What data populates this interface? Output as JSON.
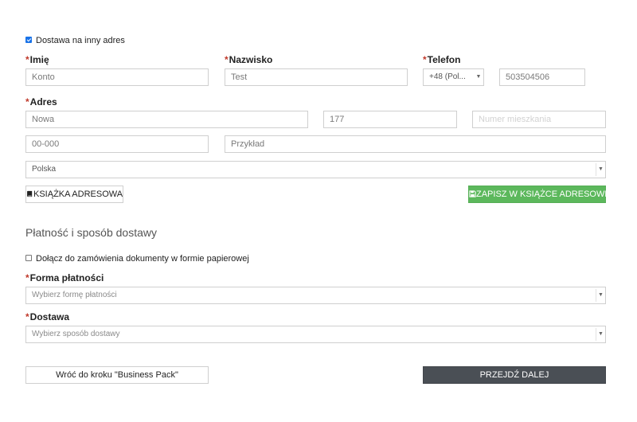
{
  "delivery_other_address": {
    "label": "Dostawa na inny adres",
    "checked": true
  },
  "fields": {
    "first_name": {
      "label": "Imię",
      "value": "Konto"
    },
    "last_name": {
      "label": "Nazwisko",
      "value": "Test"
    },
    "phone": {
      "label": "Telefon",
      "prefix": "+48 (Pol...",
      "value": "503504506"
    },
    "address": {
      "label": "Adres",
      "street": "Nowa",
      "building": "177",
      "apartment_placeholder": "Numer mieszkania",
      "postal_code": "00-000",
      "city": "Przykład",
      "country": "Polska"
    }
  },
  "buttons": {
    "address_book": "KSIĄŻKA ADRESOWA",
    "save_address_book": "ZAPISZ W KSIĄŻCE ADRESOWEJ",
    "back": "Wróć do kroku \"Business Pack\"",
    "next": "PRZEJDŹ DALEJ"
  },
  "payment_section": {
    "title": "Płatność i sposób dostawy",
    "paper_docs": {
      "label": "Dołącz do zamówienia dokumenty w formie papierowej",
      "checked": false
    },
    "payment_method": {
      "label": "Forma płatności",
      "placeholder": "Wybierz formę płatności"
    },
    "delivery": {
      "label": "Dostawa",
      "placeholder": "Wybierz sposób dostawy"
    }
  },
  "icons": {
    "address_book": "book-icon",
    "save": "floppy-disk-icon",
    "dropdown": "chevron-down-icon"
  },
  "colors": {
    "required": "#c0392b",
    "save_button": "#5cb85c",
    "next_button": "#4a4f55",
    "checkbox_checked": "#1a73e8"
  }
}
